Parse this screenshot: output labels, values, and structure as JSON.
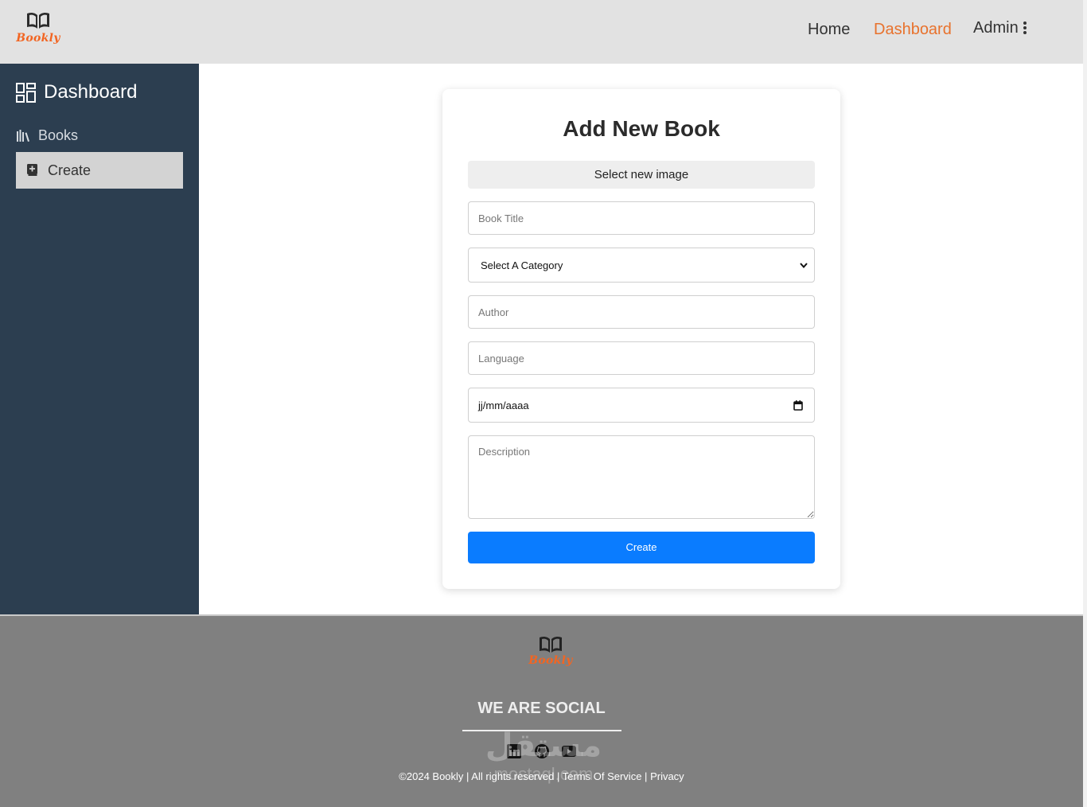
{
  "header": {
    "logo_text": "Bookly",
    "nav": [
      {
        "label": "Home",
        "active": false
      },
      {
        "label": "Dashboard",
        "active": true
      },
      {
        "label": "Admin",
        "active": false
      }
    ],
    "accent_color": "#e8722d"
  },
  "sidebar": {
    "title": "Dashboard",
    "title_icon": "dashboard-grid-icon",
    "items": [
      {
        "label": "Books",
        "icon": "books-icon",
        "active": false
      },
      {
        "label": "Create",
        "icon": "add-book-icon",
        "active": true
      }
    ],
    "background_color": "#2c3e50"
  },
  "form": {
    "title": "Add New Book",
    "image_button_label": "Select new image",
    "fields": {
      "title_placeholder": "Book Title",
      "category_selected": "Select A Category",
      "author_placeholder": "Author",
      "language_placeholder": "Language",
      "date_value": "jj/mm/aaaa",
      "description_placeholder": "Description"
    },
    "submit_label": "Create",
    "submit_color": "#0a7cff"
  },
  "footer": {
    "logo_text": "Bookly",
    "social_heading": "WE ARE SOCIAL",
    "social_icons": [
      "linkedin-icon",
      "github-icon",
      "youtube-icon"
    ],
    "copyright": "©2024 Bookly | All rights reserved |",
    "links": {
      "terms": "Terms Of Service",
      "privacy": "Privacy"
    },
    "separator": "|",
    "background_color": "#808080"
  },
  "watermark": {
    "arabic": "مستقل",
    "latin": "mostaql.com"
  }
}
